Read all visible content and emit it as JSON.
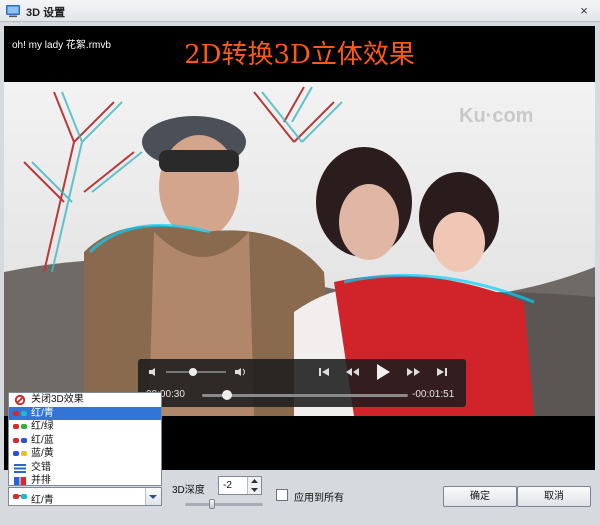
{
  "window": {
    "title": "3D 设置",
    "close_icon": "×"
  },
  "video": {
    "file_name": "oh! my lady 花絮.rmvb",
    "overlay_title": "2D转换3D立体效果",
    "elapsed": "00:00:30",
    "remaining": "-00:01:51",
    "progress": 0.12,
    "volume": 0.45
  },
  "effects": {
    "options": [
      "关闭3D效果",
      "红/青",
      "红/绿",
      "红/蓝",
      "蓝/黄",
      "交错",
      "并排"
    ],
    "selected_index": 1,
    "selected_label": "红/青"
  },
  "depth": {
    "label": "3D深度",
    "value": "-2",
    "slider_level": 0.35
  },
  "apply_all": {
    "label": "应用到所有",
    "checked": false
  },
  "buttons": {
    "ok": "确定",
    "cancel": "取消"
  },
  "colors": {
    "overlay_title": "#ff5a14",
    "selected_row": "#3275d6"
  }
}
